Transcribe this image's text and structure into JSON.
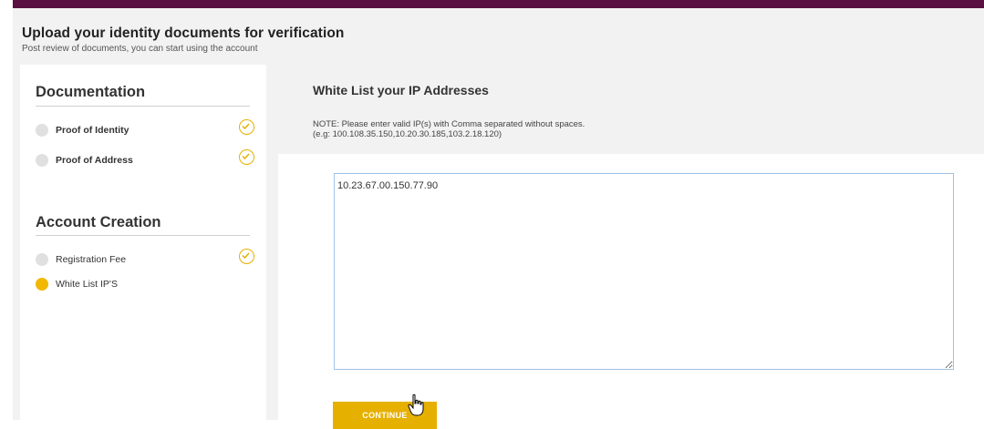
{
  "header": {
    "title": "Upload your identity documents for verification",
    "subtitle": "Post review of documents, you can start using the account"
  },
  "sidebar": {
    "sections": [
      {
        "title": "Documentation",
        "steps": [
          {
            "label": "Proof of Identity",
            "status": "completed"
          },
          {
            "label": "Proof of Address",
            "status": "completed"
          }
        ]
      },
      {
        "title": "Account Creation",
        "steps": [
          {
            "label": "Registration Fee",
            "status": "completed"
          },
          {
            "label": "White List IP'S",
            "status": "current"
          }
        ]
      }
    ]
  },
  "main": {
    "title": "White List your IP Addresses",
    "note_line1": "NOTE: Please enter valid IP(s) with Comma separated without spaces.",
    "note_line2": "(e.g: 100.108.35.150,10.20.30.185,103.2.18.120)",
    "ip_value": "10.23.67.00.150.77.90",
    "continue_label": "CONTINUE"
  },
  "colors": {
    "topbar": "#5a1040",
    "accent": "#e6b000",
    "step_pending": "#e0e0e0"
  }
}
